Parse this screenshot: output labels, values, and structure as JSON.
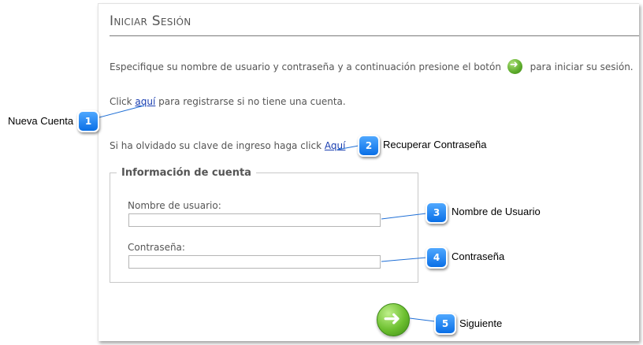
{
  "panel": {
    "title": "Iniciar Sesión",
    "instruction_before": "Especifique su nombre de usuario y contraseña y a continuación presione el botón",
    "instruction_after": "para iniciar su sesión.",
    "register_prefix": "Click ",
    "register_link": "aquí",
    "register_suffix": " para registrarse si no tiene una cuenta.",
    "recover_prefix": "Si ha olvidado su clave de ingreso haga click ",
    "recover_link": "Aquí",
    "fieldset_legend": "Información de cuenta",
    "username_label": "Nombre de usuario:",
    "username_value": "",
    "password_label": "Contraseña:",
    "password_value": ""
  },
  "callouts": [
    {
      "number": "1",
      "label": "Nueva Cuenta"
    },
    {
      "number": "2",
      "label": "Recuperar Contraseña"
    },
    {
      "number": "3",
      "label": "Nombre de Usuario"
    },
    {
      "number": "4",
      "label": "Contraseña"
    },
    {
      "number": "5",
      "label": "Siguiente"
    }
  ],
  "icons": {
    "next_small": "arrow-right-circle-icon",
    "next_big": "arrow-right-circle-icon"
  },
  "colors": {
    "link": "#1a3eb0",
    "badge": "#0a6fe6",
    "go_button": "#5cab2a"
  }
}
